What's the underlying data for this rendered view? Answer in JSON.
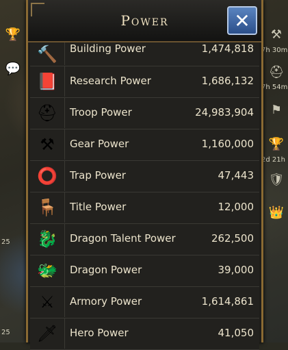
{
  "header": {
    "title": "Power"
  },
  "rows": [
    {
      "label": "Building Power",
      "value": "1,474,818",
      "icon": "hammer-icon",
      "glyph": "🔨"
    },
    {
      "label": "Research Power",
      "value": "1,686,132",
      "icon": "book-icon",
      "glyph": "📕"
    },
    {
      "label": "Troop Power",
      "value": "24,983,904",
      "icon": "helmet-icon",
      "glyph": "⛑"
    },
    {
      "label": "Gear Power",
      "value": "1,160,000",
      "icon": "anvil-icon",
      "glyph": "⚒"
    },
    {
      "label": "Trap Power",
      "value": "47,443",
      "icon": "trap-icon",
      "glyph": "⭕"
    },
    {
      "label": "Title Power",
      "value": "12,000",
      "icon": "throne-icon",
      "glyph": "🪑"
    },
    {
      "label": "Dragon Talent Power",
      "value": "262,500",
      "icon": "dragon-head-icon",
      "glyph": "🐉"
    },
    {
      "label": "Dragon Power",
      "value": "39,000",
      "icon": "dragon-icon",
      "glyph": "🐲"
    },
    {
      "label": "Armory Power",
      "value": "1,614,861",
      "icon": "armory-icon",
      "glyph": "⚔"
    },
    {
      "label": "Hero Power",
      "value": "41,050",
      "icon": "sword-icon",
      "glyph": "🗡"
    }
  ],
  "side": {
    "timer1": "7h 30m",
    "timer2": "7h 54m",
    "timer3": "2d 21h",
    "level_left1": "25",
    "level_left2": "25"
  },
  "close_glyph": "✕"
}
